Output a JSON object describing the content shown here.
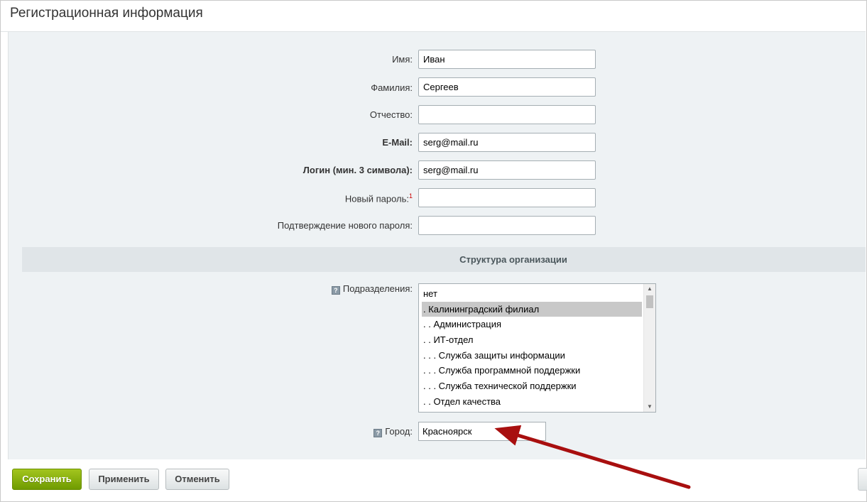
{
  "header": {
    "title": "Регистрационная информация"
  },
  "form": {
    "name": {
      "label": "Имя:",
      "value": "Иван"
    },
    "surname": {
      "label": "Фамилия:",
      "value": "Сергеев"
    },
    "patronymic": {
      "label": "Отчество:",
      "value": ""
    },
    "email": {
      "label": "E-Mail:",
      "value": "serg@mail.ru"
    },
    "login": {
      "label": "Логин (мин. 3 символа):",
      "value": "serg@mail.ru"
    },
    "new_password": {
      "label": "Новый пароль:",
      "footnote": "1",
      "value": ""
    },
    "confirm_password": {
      "label": "Подтверждение нового пароля:",
      "value": ""
    }
  },
  "section": {
    "title": "Структура организации"
  },
  "departments": {
    "label": "Подразделения:",
    "help_icon": "?",
    "items": [
      "нет",
      ". Калининградский филиал",
      ". . Администрация",
      ". . ИТ-отдел",
      ". . . Служба защиты информации",
      ". . . Служба программной поддержки",
      ". . . Служба технической поддержки",
      ". . Отдел качества"
    ],
    "selected_index": 1
  },
  "city": {
    "label": "Город:",
    "help_icon": "?",
    "value": "Красноярск"
  },
  "buttons": {
    "save": "Сохранить",
    "apply": "Применить",
    "cancel": "Отменить"
  },
  "colors": {
    "accent_save": "#86ad00",
    "annotation_arrow": "#a80f0f",
    "panel_bg": "#eef2f4"
  }
}
